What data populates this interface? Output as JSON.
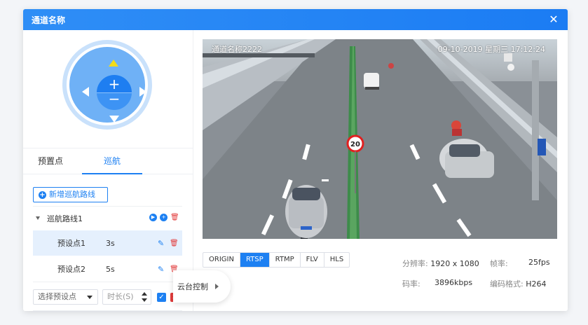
{
  "dialog": {
    "title": "通道名称",
    "close_label": "✕"
  },
  "ptz": {
    "zoom_in_label": "+",
    "zoom_out_label": "−"
  },
  "tabs": [
    {
      "label": "预置点",
      "active": false
    },
    {
      "label": "巡航",
      "active": true
    }
  ],
  "cruise": {
    "add_route_label": "新增巡航路线",
    "route_name": "巡航路线1",
    "presets": [
      {
        "name": "预设点1",
        "time": "3s",
        "selected": true
      },
      {
        "name": "预设点2",
        "time": "5s",
        "selected": false
      }
    ],
    "select_placeholder": "选择预设点",
    "duration_placeholder": "时长(S)"
  },
  "video": {
    "channel_label": "通道名称2222",
    "timestamp": "09-10-2019 星期三 17:12:24",
    "speed_sign": "20"
  },
  "protocols": [
    "ORIGIN",
    "RTSP",
    "RTMP",
    "FLV",
    "HLS"
  ],
  "active_protocol": "RTSP",
  "stats": {
    "resolution_key": "分辨率:",
    "resolution_val": "1920 x 1080",
    "fps_key": "帧率:",
    "fps_val": "25fps",
    "bitrate_key": "码率:",
    "bitrate_val": "3896kbps",
    "codec_key": "编码格式:",
    "codec_val": "H264"
  },
  "ptz_toggle_label": "云台控制",
  "colors": {
    "accent": "#1d80f2",
    "danger": "#e23b3b",
    "arrow_up": "#f3dc18"
  }
}
